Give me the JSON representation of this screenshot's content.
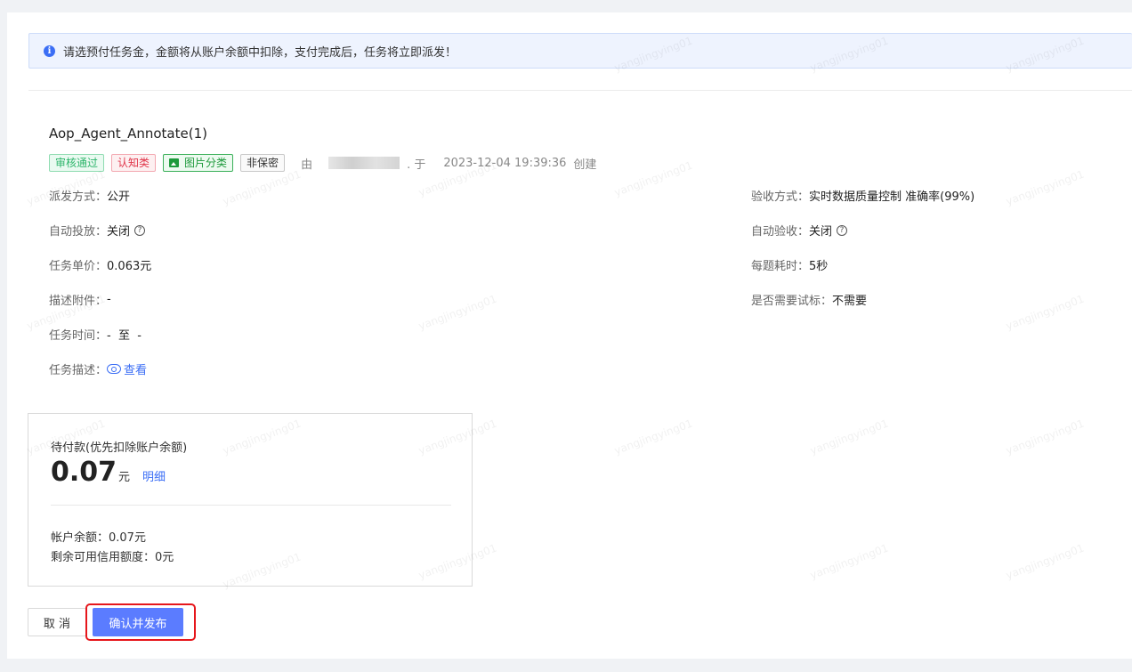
{
  "alert": {
    "icon": "info-icon",
    "text": "请选预付任务金，金额将从账户余额中扣除，支付完成后，任务将立即派发！"
  },
  "task": {
    "title": "Aop_Agent_Annotate(1)",
    "tags": {
      "status": "审核通过",
      "type": "认知类",
      "category": "图片分类",
      "privacy": "非保密"
    },
    "by_prefix": "由",
    "by_suffix": ". 于",
    "created_time": "2023-12-04 19:39:36",
    "created_suffix": "创建"
  },
  "fields_left": {
    "dispatch": {
      "label": "派发方式：",
      "value": "公开"
    },
    "auto_launch": {
      "label": "自动投放：",
      "value": "关闭"
    },
    "unit_price": {
      "label": "任务单价：",
      "value": "0.063元"
    },
    "attachment": {
      "label": "描述附件：",
      "value": "-"
    },
    "time": {
      "label": "任务时间：",
      "value": "-  至  -"
    },
    "description": {
      "label": "任务描述：",
      "link": "查看"
    }
  },
  "fields_right": {
    "acceptance": {
      "label": "验收方式：",
      "value": "实时数据质量控制 准确率(99%)"
    },
    "auto_accept": {
      "label": "自动验收：",
      "value": "关闭"
    },
    "per_item_time": {
      "label": "每题耗时：",
      "value": "5秒"
    },
    "need_trial": {
      "label": "是否需要试标：",
      "value": "不需要"
    }
  },
  "payment": {
    "label": "待付款(优先扣除账户余额)",
    "amount": "0.07",
    "unit": "元",
    "detail_link": "明细",
    "balance": "帐户余额：0.07元",
    "credit": "剩余可用信用额度：0元"
  },
  "buttons": {
    "cancel": "取 消",
    "confirm": "确认并发布"
  },
  "watermark": "yangjingying01",
  "colors": {
    "primary": "#5b7cff",
    "link": "#3b6ef5",
    "highlight": "#e6161b"
  }
}
